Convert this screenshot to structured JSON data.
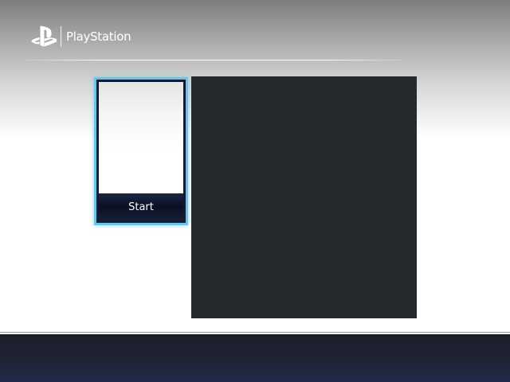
{
  "header": {
    "brand_name": "PlayStation",
    "logo_icon": "playstation-logo-icon"
  },
  "tiles": [
    {
      "label": "Start",
      "selected": true
    }
  ],
  "colors": {
    "selection_border": "#6cc4e6",
    "preview_panel": "#272a2d",
    "footer": "#1f2436",
    "label_bar": "#0f1a33"
  }
}
